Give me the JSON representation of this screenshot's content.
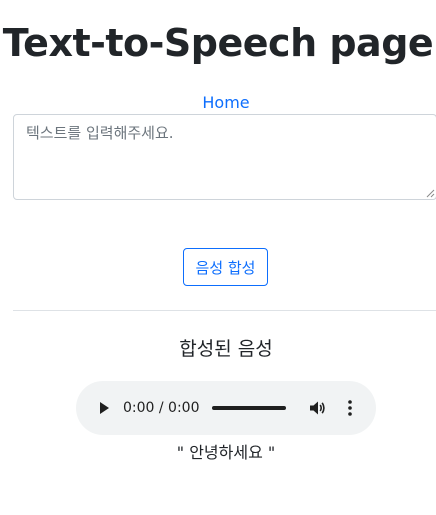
{
  "page": {
    "title": "Text-to-Speech page",
    "home_link": "Home"
  },
  "form": {
    "textarea_placeholder": "텍스트를 입력해주세요.",
    "textarea_value": "",
    "submit_label": "음성 합성"
  },
  "result": {
    "heading": "합성된 음성",
    "audio": {
      "time_display": "0:00 / 0:00",
      "play_icon": "play-icon",
      "volume_icon": "volume-icon",
      "menu_icon": "more-vert-icon"
    },
    "text": "\" 안녕하세요 \""
  },
  "colors": {
    "link": "#0d6efd",
    "player_bg": "#f1f3f4"
  }
}
